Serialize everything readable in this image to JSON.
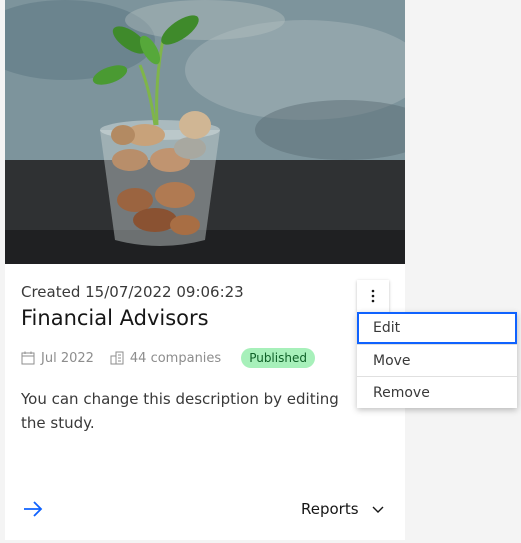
{
  "card": {
    "image_alt": "Glass of coins with a small plant",
    "created": "Created 15/07/2022 09:06:23",
    "title": "Financial Advisors",
    "date": "Jul 2022",
    "companies": "44 companies",
    "status": "Published",
    "description": "You can change this description by editing the study.",
    "reports_label": "Reports"
  },
  "menu": {
    "items": [
      "Edit",
      "Move",
      "Remove"
    ]
  },
  "colors": {
    "accent": "#0f62fe",
    "badge_bg": "#a7f0ba",
    "badge_text": "#0e6027"
  }
}
